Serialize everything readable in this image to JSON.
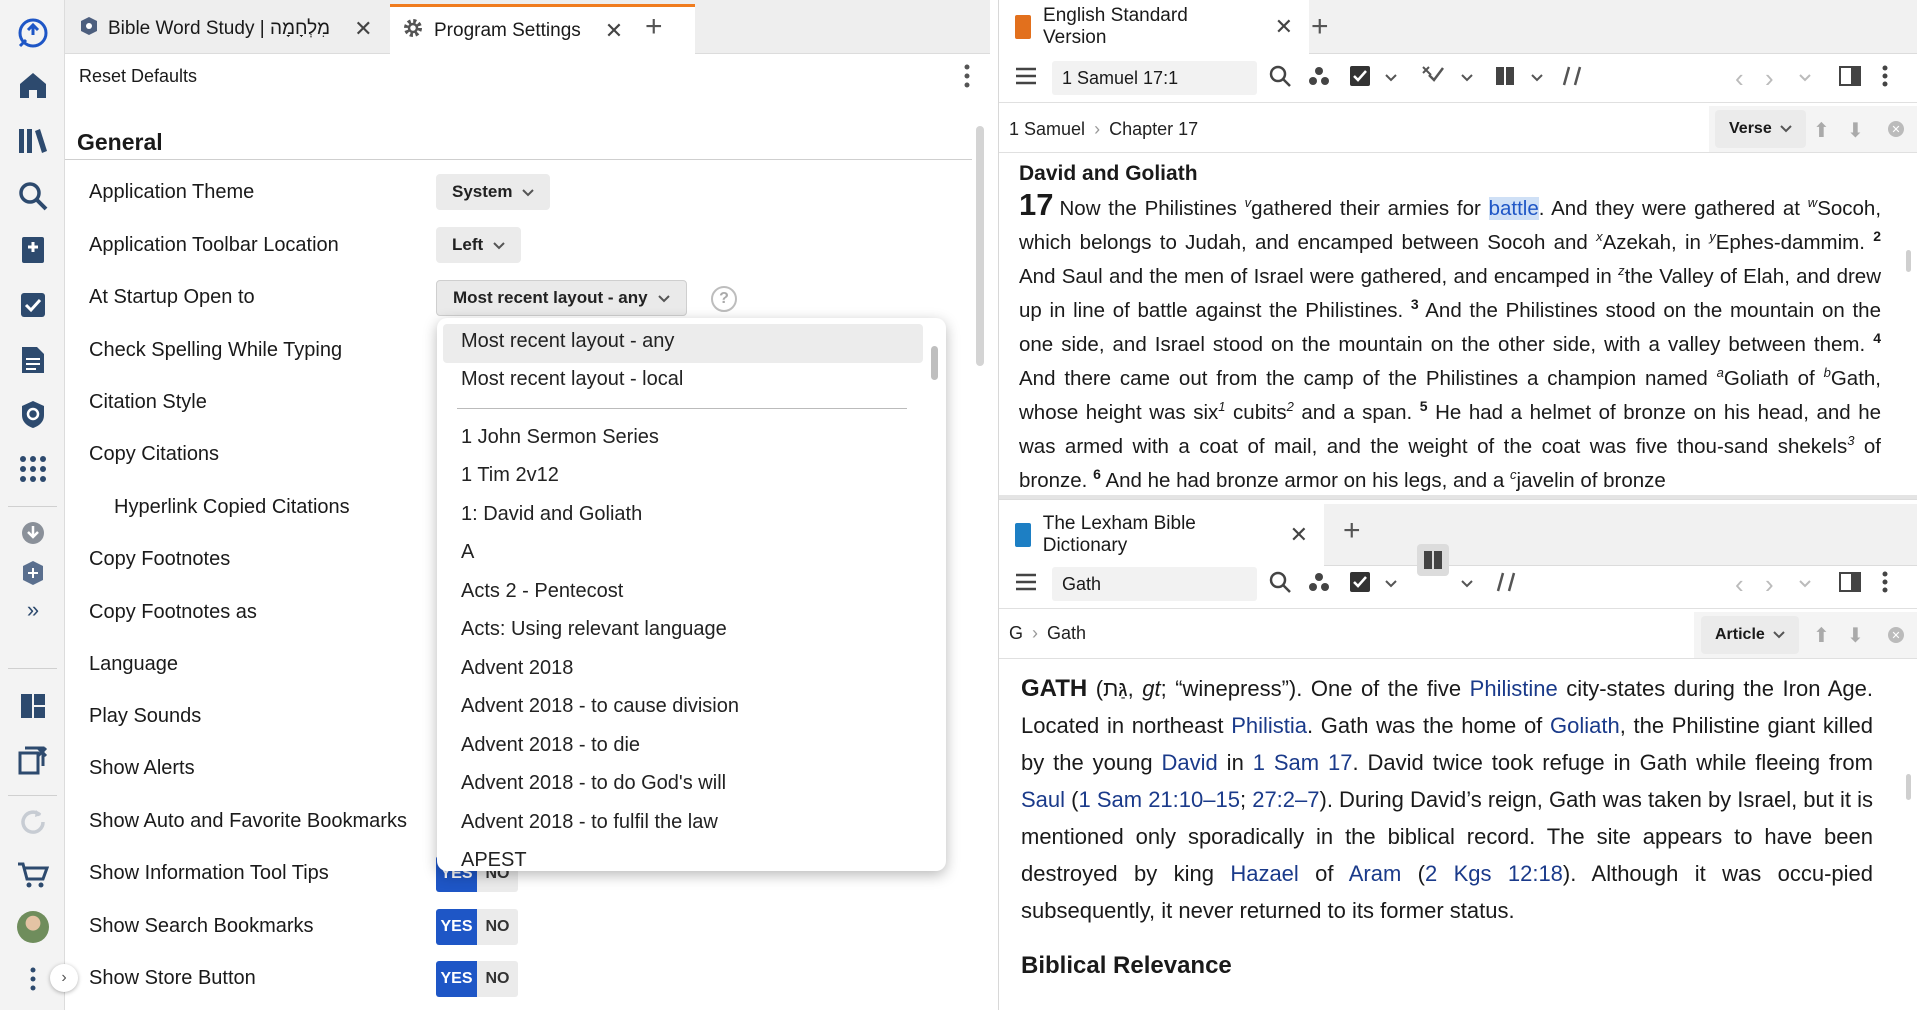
{
  "left_toolbar": {
    "icons": [
      "logos-app-icon",
      "home-icon",
      "library-icon",
      "search-icon",
      "guides-icon",
      "reading-plan-icon",
      "documents-icon",
      "layouts-icon",
      "tools-grid-icon",
      "downloads-icon",
      "sync-status-icon",
      "expand-more-icon",
      "panels-icon",
      "close-all-panels-icon",
      "refresh-icon",
      "store-cart-icon",
      "user-avatar",
      "more-menu-icon"
    ]
  },
  "left_tabs": [
    {
      "label": "Bible Word Study | מִלְחָמָה"
    },
    {
      "label": "Program Settings"
    }
  ],
  "settings": {
    "reset_defaults": "Reset Defaults",
    "section_title": "General",
    "rows": [
      {
        "label": "Application Theme"
      },
      {
        "label": "Application Toolbar Location"
      },
      {
        "label": "At Startup Open to"
      },
      {
        "label": "Check Spelling While Typing"
      },
      {
        "label": "Citation Style"
      },
      {
        "label": "Copy Citations"
      },
      {
        "label": "Hyperlink Copied Citations"
      },
      {
        "label": "Copy Footnotes"
      },
      {
        "label": "Copy Footnotes as"
      },
      {
        "label": "Language"
      },
      {
        "label": "Play Sounds"
      },
      {
        "label": "Show Alerts"
      },
      {
        "label": "Show Auto and Favorite Bookmarks"
      },
      {
        "label": "Show Information Tool Tips"
      },
      {
        "label": "Show Search Bookmarks"
      },
      {
        "label": "Show Store Button"
      }
    ],
    "theme_value": "System",
    "toolbar_location_value": "Left",
    "startup_value": "Most recent layout - any",
    "help_glyph": "?",
    "yes": "YES",
    "no": "NO"
  },
  "startup_dropdown": {
    "options": [
      "Most recent layout - any",
      "Most recent layout - local",
      "1 John Sermon Series",
      "1 Tim 2v12",
      "1: David and Goliath",
      "A",
      "Acts 2 - Pentecost",
      "Acts: Using relevant language",
      "Advent 2018",
      "Advent 2018 - to cause division",
      "Advent 2018 - to die",
      "Advent 2018 - to do God's will",
      "Advent 2018 - to fulfil the law",
      "APEST"
    ],
    "selected": "Most recent layout - any"
  },
  "bible_panel": {
    "tab_title": "English Standard Version",
    "reference": "1 Samuel 17:1",
    "breadcrumb": [
      "1 Samuel",
      "Chapter 17"
    ],
    "view_mode": "Verse",
    "heading": "David and Goliath",
    "chapter_num": "17",
    "highlight_word": "battle"
  },
  "dictionary_panel": {
    "tab_title": "The Lexham Bible Dictionary",
    "search": "Gath",
    "breadcrumb": [
      "G",
      "Gath"
    ],
    "view_mode": "Article",
    "headword": "GATH",
    "section_heading": "Biblical Relevance"
  },
  "colors": {
    "accent_orange": "#f07c1e",
    "yes_blue": "#1e56c6",
    "link_blue": "#1a3a8a",
    "highlight_bg": "#cfe0f6"
  }
}
